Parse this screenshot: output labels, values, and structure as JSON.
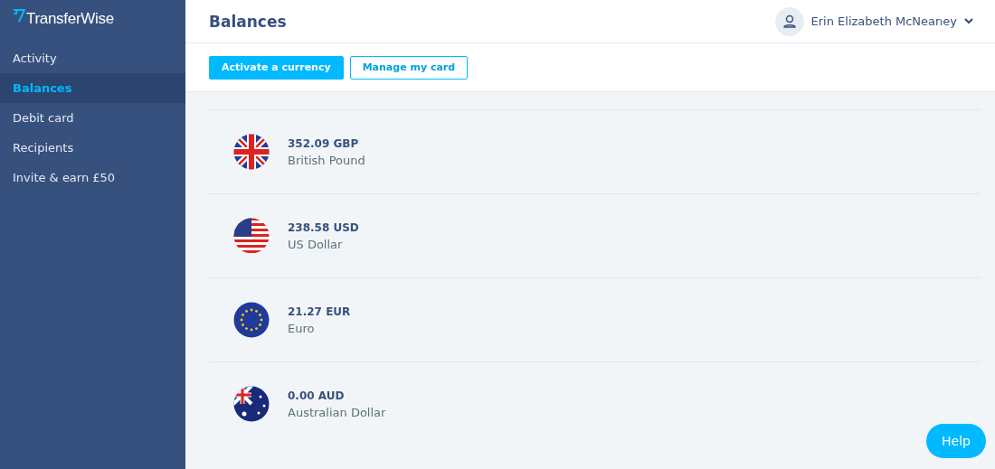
{
  "sidebar": {
    "logo": "TransferWise",
    "items": [
      {
        "label": "Activity",
        "selected": false
      },
      {
        "label": "Balances",
        "selected": true
      },
      {
        "label": "Debit card",
        "selected": false
      },
      {
        "label": "Recipients",
        "selected": false
      },
      {
        "label": "Invite & earn £50",
        "selected": false
      }
    ]
  },
  "header": {
    "title": "Balances",
    "user": "Erin Elizabeth McNeaney"
  },
  "toolbar": {
    "buttons": [
      {
        "label": "Activate a currency",
        "kind": "primary"
      },
      {
        "label": "Manage my card",
        "kind": "outline"
      }
    ]
  },
  "balances": [
    {
      "amount": "352.09 GBP",
      "currency": "British Pound",
      "kind": "gb"
    },
    {
      "amount": "238.58 USD",
      "currency": "US Dollar",
      "kind": "us"
    },
    {
      "amount": "21.27 EUR",
      "currency": "Euro",
      "kind": "eu"
    },
    {
      "amount": "0.00 AUD",
      "currency": "Australian Dollar",
      "kind": "au"
    }
  ],
  "help": "Help"
}
